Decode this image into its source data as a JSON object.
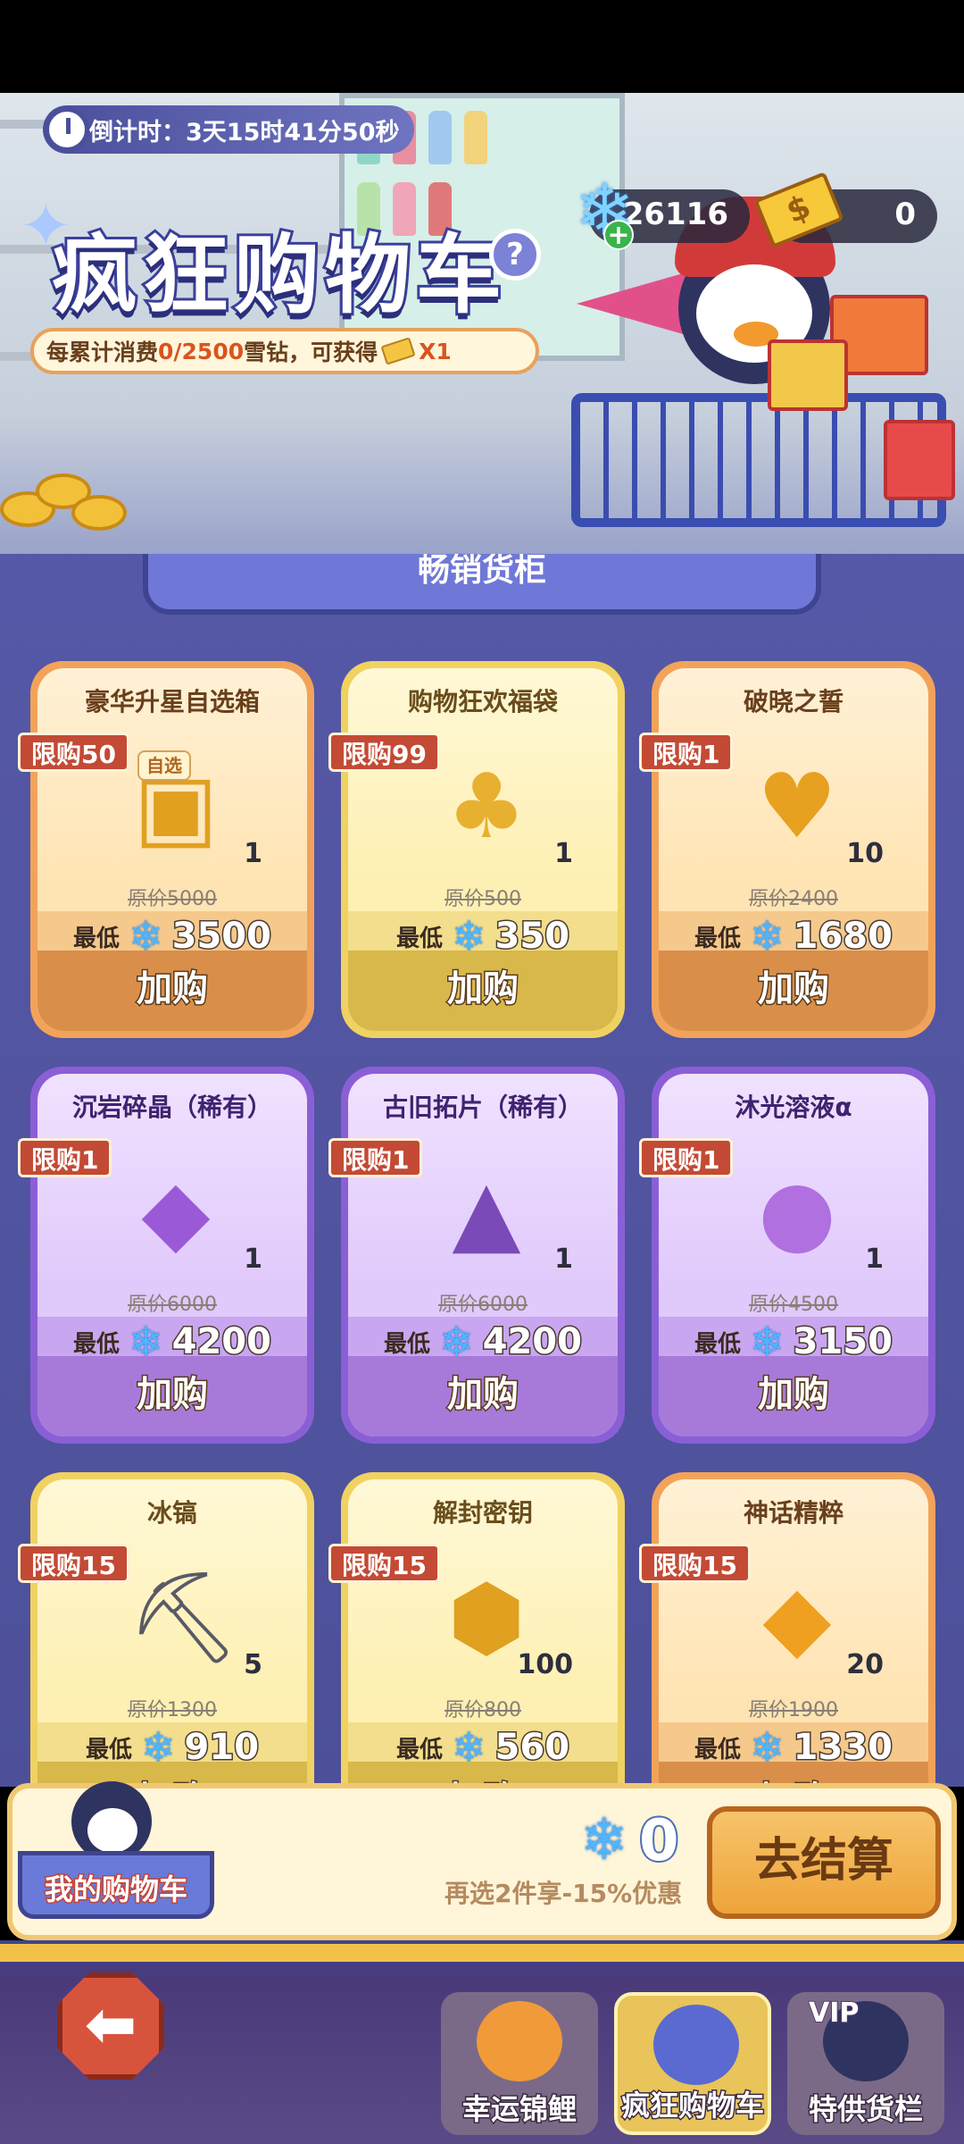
{
  "header": {
    "countdown": "倒计时：3天15时41分50秒",
    "title": "疯狂购物车",
    "help": "?",
    "progress": {
      "prefix": "每累计消费",
      "value": "0/2500",
      "suffix": "雪钻，可获得",
      "reward": "X1"
    },
    "currency_snow": "26116",
    "currency_ticket": "0"
  },
  "section_title": "畅销货柜",
  "cards": [
    {
      "name": "豪华升星自选箱",
      "limit": "限购50",
      "tag": "自选",
      "qty": "1",
      "orig": "原价5000",
      "min_label": "最低",
      "price": "3500",
      "buy": "加购",
      "theme": "orange",
      "icon": "treasure-chest-icon"
    },
    {
      "name": "购物狂欢福袋",
      "limit": "限购99",
      "qty": "1",
      "orig": "原价500",
      "min_label": "最低",
      "price": "350",
      "buy": "加购",
      "theme": "yellow",
      "icon": "lucky-bag-icon"
    },
    {
      "name": "破晓之誓",
      "limit": "限购1",
      "qty": "10",
      "orig": "原价2400",
      "min_label": "最低",
      "price": "1680",
      "buy": "加购",
      "theme": "orange",
      "icon": "gold-amulet-icon"
    },
    {
      "name": "沉岩碎晶（稀有）",
      "limit": "限购1",
      "qty": "1",
      "orig": "原价6000",
      "min_label": "最低",
      "price": "4200",
      "buy": "加购",
      "theme": "purple",
      "icon": "crystal-bowl-icon"
    },
    {
      "name": "古旧拓片（稀有）",
      "limit": "限购1",
      "qty": "1",
      "orig": "原价6000",
      "min_label": "最低",
      "price": "4200",
      "buy": "加购",
      "theme": "purple",
      "icon": "rune-card-icon"
    },
    {
      "name": "沐光溶液α",
      "limit": "限购1",
      "qty": "1",
      "orig": "原价4500",
      "min_label": "最低",
      "price": "3150",
      "buy": "加购",
      "theme": "purple",
      "icon": "potion-icon"
    },
    {
      "name": "冰镐",
      "limit": "限购15",
      "qty": "5",
      "orig": "原价1300",
      "min_label": "最低",
      "price": "910",
      "buy": "加购",
      "theme": "yellow",
      "icon": "pickaxe-icon"
    },
    {
      "name": "解封密钥",
      "limit": "限购15",
      "qty": "100",
      "orig": "原价800",
      "min_label": "最低",
      "price": "560",
      "buy": "加购",
      "theme": "yellow",
      "icon": "key-icon"
    },
    {
      "name": "神话精粹",
      "limit": "限购15",
      "qty": "20",
      "orig": "原价1900",
      "min_label": "最低",
      "price": "1330",
      "buy": "加购",
      "theme": "orange",
      "icon": "gold-crystal-icon"
    }
  ],
  "cart": {
    "label": "我的购物车",
    "total": "0",
    "hint": "再选2件享-15%优惠",
    "checkout": "去结算"
  },
  "nav": {
    "tab1": "幸运锦鲤",
    "tab2": "疯狂购物车",
    "tab3": "特供货栏",
    "vip": "VIP"
  },
  "colors": {
    "accent": "#5558a6",
    "limit_badge": "#c34a34",
    "snow": "#4fb6ff"
  }
}
